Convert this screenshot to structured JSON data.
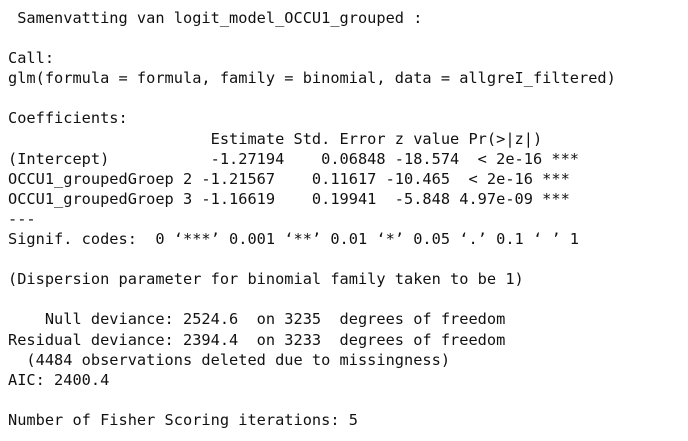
{
  "console": {
    "lines": [
      " Samenvatting van logit_model_OCCU1_grouped :",
      "",
      "Call:",
      "glm(formula = formula, family = binomial, data = allgreI_filtered)",
      "",
      "Coefficients:",
      "                      Estimate Std. Error z value Pr(>|z|)    ",
      "(Intercept)           -1.27194    0.06848 -18.574  < 2e-16 ***",
      "OCCU1_groupedGroep 2 -1.21567    0.11617 -10.465  < 2e-16 ***",
      "OCCU1_groupedGroep 3 -1.16619    0.19941  -5.848 4.97e-09 ***",
      "---",
      "Signif. codes:  0 ‘***’ 0.001 ‘**’ 0.01 ‘*’ 0.05 ‘.’ 0.1 ‘ ’ 1",
      "",
      "(Dispersion parameter for binomial family taken to be 1)",
      "",
      "    Null deviance: 2524.6  on 3235  degrees of freedom",
      "Residual deviance: 2394.4  on 3233  degrees of freedom",
      "  (4484 observations deleted due to missingness)",
      "AIC: 2400.4",
      "",
      "Number of Fisher Scoring iterations: 5"
    ]
  }
}
